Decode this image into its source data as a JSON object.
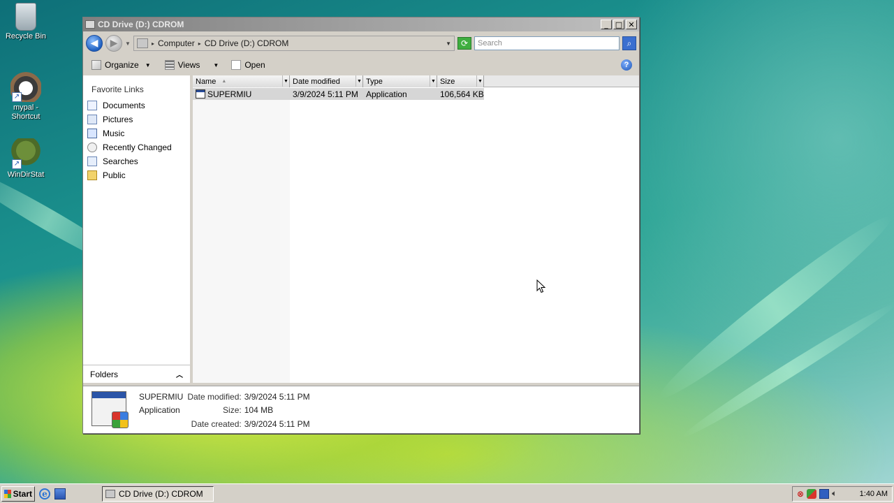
{
  "desktop": {
    "icons": [
      {
        "label": "Recycle Bin",
        "icon": "recycle-bin-icon"
      },
      {
        "label": "mypal - Shortcut",
        "icon": "raccoon-icon"
      },
      {
        "label": "WinDirStat",
        "icon": "tree-icon"
      }
    ]
  },
  "window": {
    "title": "CD Drive (D:) CDROM",
    "controls": {
      "minimize": "_",
      "maximize": "□",
      "close": "✕"
    },
    "address": {
      "crumbs": [
        "Computer",
        "CD Drive (D:) CDROM"
      ]
    },
    "search": {
      "placeholder": "Search"
    },
    "toolbar": {
      "organize": "Organize",
      "views": "Views",
      "open": "Open",
      "help": "?"
    },
    "nav": {
      "header": "Favorite Links",
      "items": [
        "Documents",
        "Pictures",
        "Music",
        "Recently Changed",
        "Searches",
        "Public"
      ],
      "folders_label": "Folders"
    },
    "columns": [
      "Name",
      "Date modified",
      "Type",
      "Size"
    ],
    "files": [
      {
        "name": "SUPERMIU",
        "date_modified": "3/9/2024 5:11 PM",
        "type": "Application",
        "size": "106,564 KB"
      }
    ],
    "details": {
      "name": "SUPERMIU",
      "type": "Application",
      "date_modified_label": "Date modified:",
      "date_modified": "3/9/2024 5:11 PM",
      "size_label": "Size:",
      "size": "104 MB",
      "date_created_label": "Date created:",
      "date_created": "3/9/2024 5:11 PM"
    }
  },
  "taskbar": {
    "start": "Start",
    "task": "CD Drive (D:) CDROM",
    "clock": "1:40 AM"
  }
}
